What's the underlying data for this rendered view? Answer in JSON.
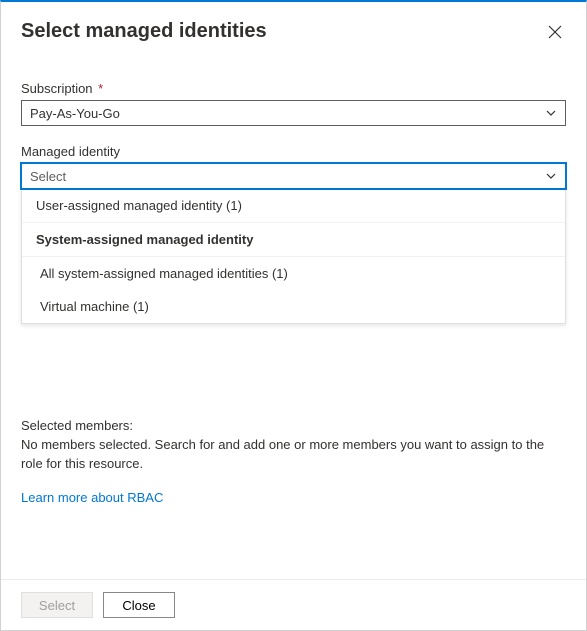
{
  "header": {
    "title": "Select managed identities"
  },
  "fields": {
    "subscription": {
      "label": "Subscription",
      "required_mark": "*",
      "value": "Pay-As-You-Go"
    },
    "managed_identity": {
      "label": "Managed identity",
      "placeholder": "Select",
      "dropdown": {
        "user_assigned": "User-assigned managed identity (1)",
        "system_header": "System-assigned managed identity",
        "all_system": "All system-assigned managed identities (1)",
        "vm": "Virtual machine (1)"
      }
    }
  },
  "members": {
    "label": "Selected members:",
    "hint": "No members selected. Search for and add one or more members you want to assign to the role for this resource."
  },
  "links": {
    "learn_rbac": "Learn more about RBAC"
  },
  "buttons": {
    "select": "Select",
    "close": "Close"
  }
}
